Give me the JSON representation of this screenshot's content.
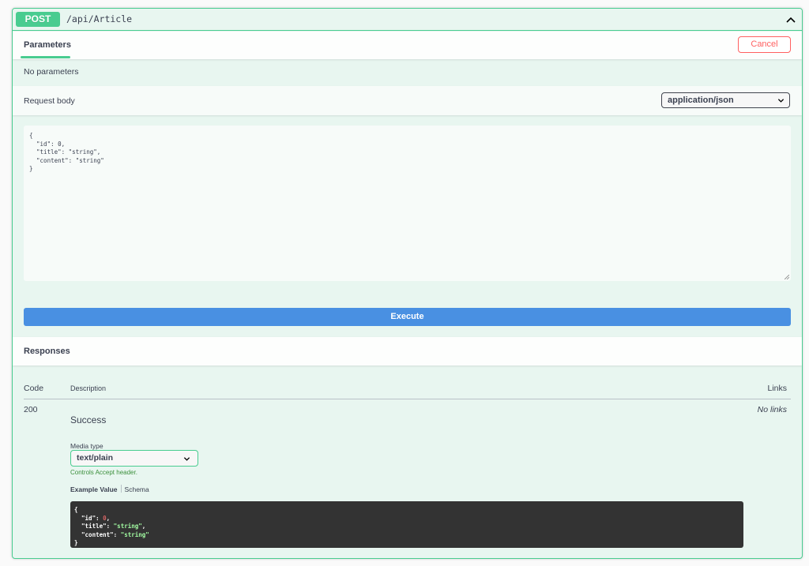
{
  "endpoint": {
    "method": "POST",
    "path": "/api/Article",
    "accent_color": "#49cc90"
  },
  "parameters": {
    "tab_label": "Parameters",
    "cancel_label": "Cancel",
    "empty_text": "No parameters"
  },
  "request_body": {
    "label": "Request body",
    "content_type": "application/json",
    "lines": [
      "{",
      "  \"id\": 0,",
      "  \"title\": \"string\",",
      "  \"content\": \"string\"",
      "}"
    ]
  },
  "execute_label": "Execute",
  "responses": {
    "title": "Responses",
    "columns": {
      "code": "Code",
      "description": "Description",
      "links": "Links"
    },
    "rows": [
      {
        "code": "200",
        "description": "Success",
        "links": "No links",
        "media_type_label": "Media type",
        "media_type": "text/plain",
        "controls_hint": "Controls Accept header.",
        "tabs": [
          "Example Value",
          "Schema"
        ],
        "example": {
          "open": "{",
          "id_key": "\"id\"",
          "id_val": "0",
          "title_key": "\"title\"",
          "title_val": "\"string\"",
          "content_key": "\"content\"",
          "content_val": "\"string\"",
          "close": "}"
        }
      }
    ]
  },
  "icons": {
    "collapse": "chevron-up-icon",
    "select": "chevron-down-icon"
  }
}
